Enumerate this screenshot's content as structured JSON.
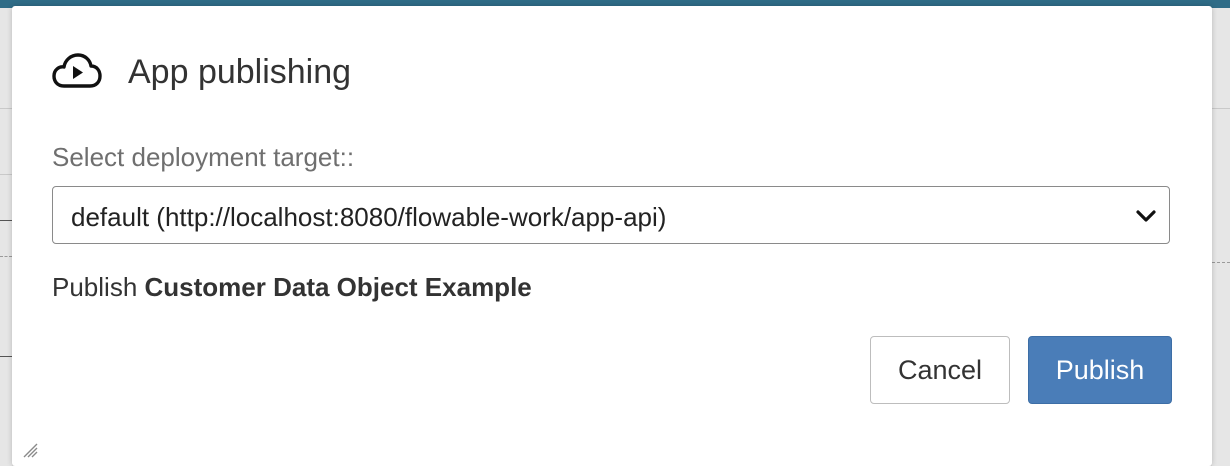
{
  "dialog": {
    "title": "App publishing",
    "title_icon": "cloud-play-icon",
    "select_label": "Select deployment target::",
    "deployment_target": {
      "selected": "default (http://localhost:8080/flowable-work/app-api)",
      "icon": "chevron-down-icon"
    },
    "publish_prefix": "Publish",
    "publish_name": "Customer Data Object Example",
    "cancel_label": "Cancel",
    "publish_label": "Publish"
  },
  "colors": {
    "primary": "#4a7db8",
    "header_bar": "#2f6c87"
  }
}
